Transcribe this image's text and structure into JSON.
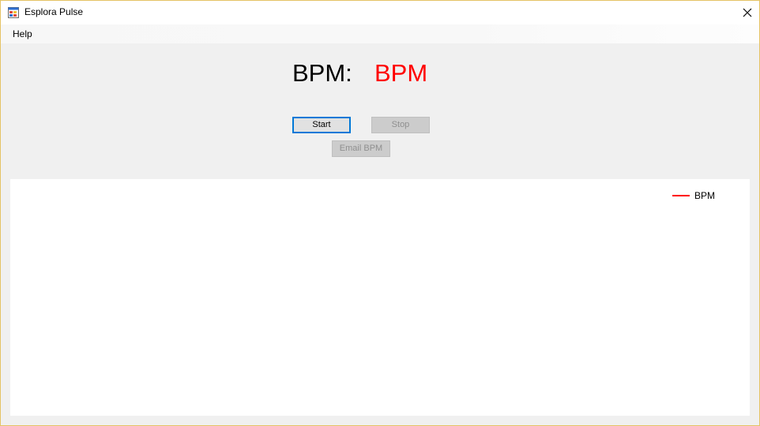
{
  "window": {
    "title": "Esplora Pulse",
    "close_glyph": "✕"
  },
  "menu": {
    "items": [
      {
        "label": "Help"
      }
    ]
  },
  "reading": {
    "label": "BPM:",
    "value": "BPM",
    "value_color": "#ff0000"
  },
  "buttons": {
    "start": {
      "label": "Start",
      "enabled": true
    },
    "stop": {
      "label": "Stop",
      "enabled": false
    },
    "email": {
      "label": "Email BPM",
      "enabled": false
    }
  },
  "chart": {
    "legend": [
      {
        "label": "BPM",
        "color": "#ff0000"
      }
    ]
  },
  "chart_data": {
    "type": "line",
    "series": [
      {
        "name": "BPM",
        "values": []
      }
    ]
  }
}
